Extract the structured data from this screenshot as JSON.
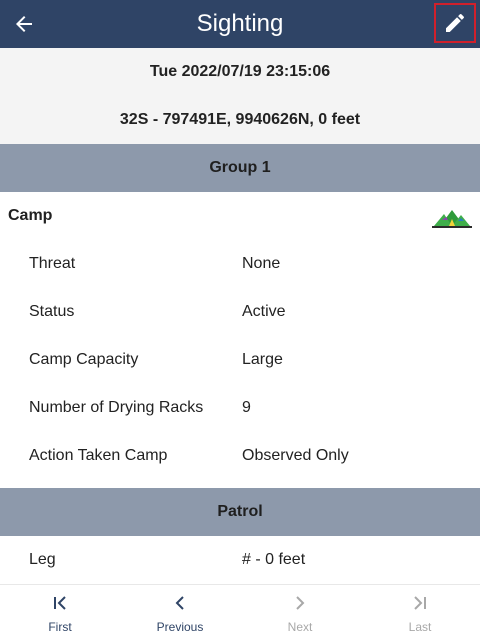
{
  "header": {
    "title": "Sighting"
  },
  "sighting": {
    "datetime": "Tue 2022/07/19 23:15:06",
    "location": "32S - 797491E, 9940626N, 0 feet"
  },
  "group1": {
    "title": "Group 1",
    "category": "Camp",
    "category_icon": "tent-icon",
    "rows": [
      {
        "label": "Threat",
        "value": "None"
      },
      {
        "label": "Status",
        "value": "Active"
      },
      {
        "label": "Camp Capacity",
        "value": "Large"
      },
      {
        "label": "Number of Drying Racks",
        "value": "9"
      },
      {
        "label": "Action Taken Camp",
        "value": "Observed Only"
      }
    ]
  },
  "patrol": {
    "title": "Patrol",
    "rows": [
      {
        "label": "Leg",
        "value": "# - 0 feet"
      }
    ]
  },
  "footer": {
    "first": "First",
    "previous": "Previous",
    "next": "Next",
    "last": "Last"
  },
  "colors": {
    "appbar": "#2f4466",
    "group_header": "#8d99ab",
    "highlight_border": "#d0202b",
    "tent_green": "#2e9b3a"
  }
}
